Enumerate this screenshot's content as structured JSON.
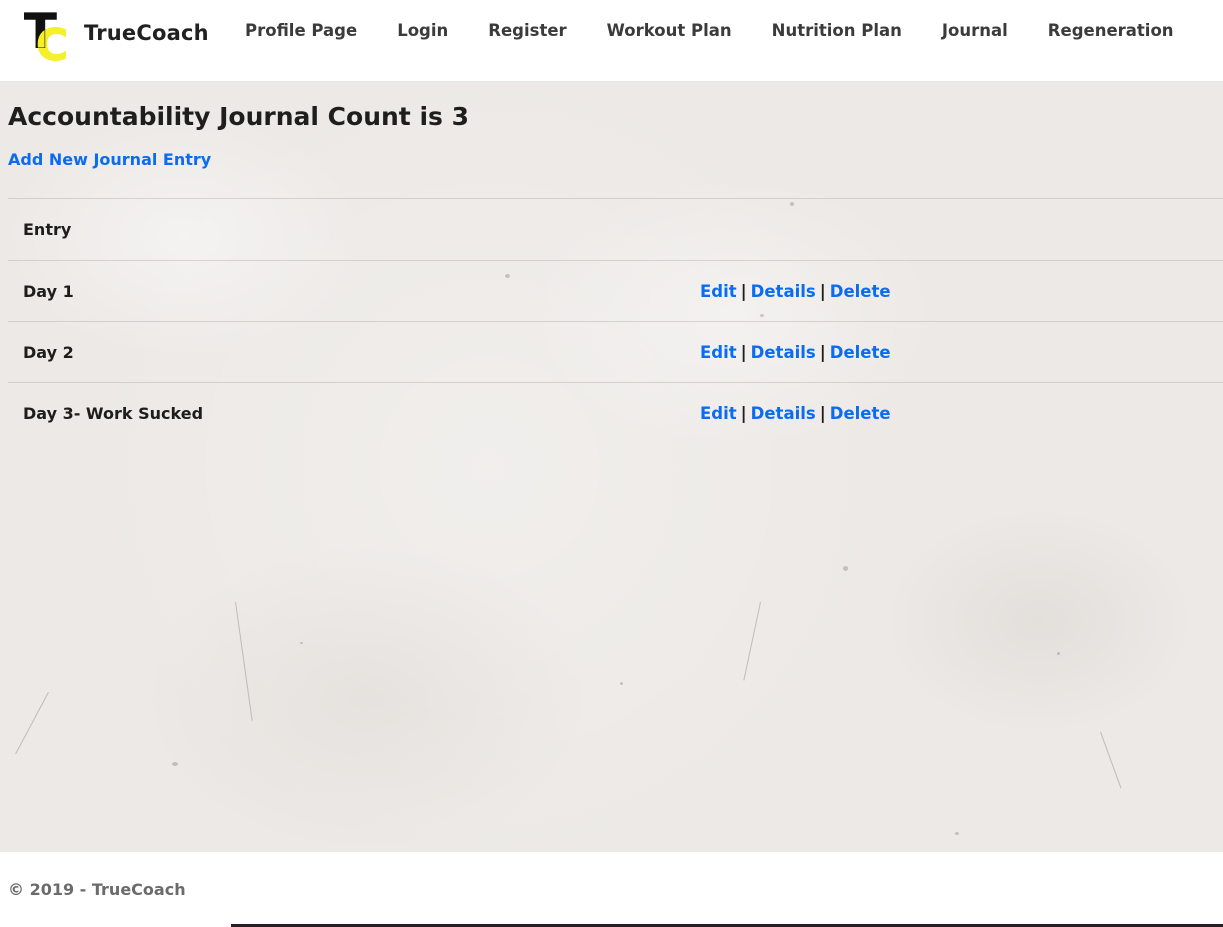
{
  "brand": {
    "name": "TrueCoach",
    "logo_letters": [
      "T",
      "C"
    ],
    "logo_colors": {
      "t": "#111111",
      "c": "#f5f02a"
    }
  },
  "nav": {
    "items": [
      {
        "label": "Profile Page"
      },
      {
        "label": "Login"
      },
      {
        "label": "Register"
      },
      {
        "label": "Workout Plan"
      },
      {
        "label": "Nutrition Plan"
      },
      {
        "label": "Journal"
      },
      {
        "label": "Regeneration"
      }
    ]
  },
  "main": {
    "title": "Accountability Journal Count is 3",
    "add_link": "Add New Journal Entry",
    "table": {
      "header": {
        "entry": "Entry"
      },
      "rows": [
        {
          "entry": "Day 1",
          "edit": "Edit",
          "details": "Details",
          "delete": "Delete"
        },
        {
          "entry": "Day 2",
          "edit": "Edit",
          "details": "Details",
          "delete": "Delete"
        },
        {
          "entry": "Day 3- Work Sucked",
          "edit": "Edit",
          "details": "Details",
          "delete": "Delete"
        }
      ],
      "separator": "|"
    }
  },
  "footer": {
    "text": "© 2019 - TrueCoach"
  },
  "colors": {
    "link": "#0a6cf0",
    "nav_text": "#3b3b3b",
    "footer_text": "#6b6b6b",
    "background": "#ece9e6"
  }
}
